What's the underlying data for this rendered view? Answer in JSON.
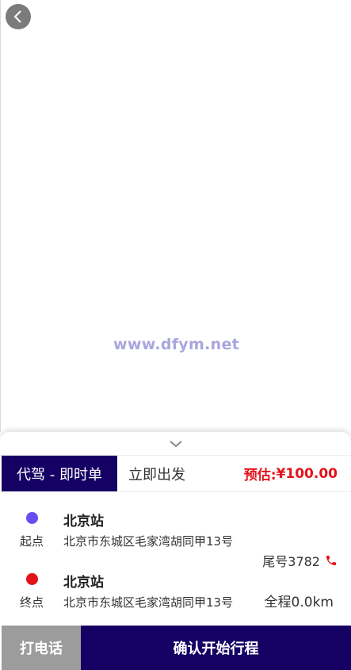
{
  "watermark": "www.dfym.net",
  "order": {
    "type_label": "代驾 - 即时单",
    "depart_label": "立即出发",
    "estimate_label": "预估:",
    "estimate_amount": "¥100.00"
  },
  "start": {
    "tag": "起点",
    "name": "北京站",
    "address": "北京市东城区毛家湾胡同甲13号"
  },
  "end": {
    "tag": "终点",
    "name": "北京站",
    "address": "北京市东城区毛家湾胡同甲13号"
  },
  "tail_number": "尾号3782",
  "distance": "全程0.0km",
  "buttons": {
    "call": "打电话",
    "confirm": "确认开始行程"
  },
  "colors": {
    "brand": "#150064",
    "price": "#e3131b",
    "start_dot": "#6a4cf0",
    "end_dot": "#e3131b",
    "call_bg": "#9c9c9c"
  },
  "icons": {
    "back": "chevron-left-icon",
    "collapse": "chevron-down-icon",
    "phone": "phone-icon"
  }
}
